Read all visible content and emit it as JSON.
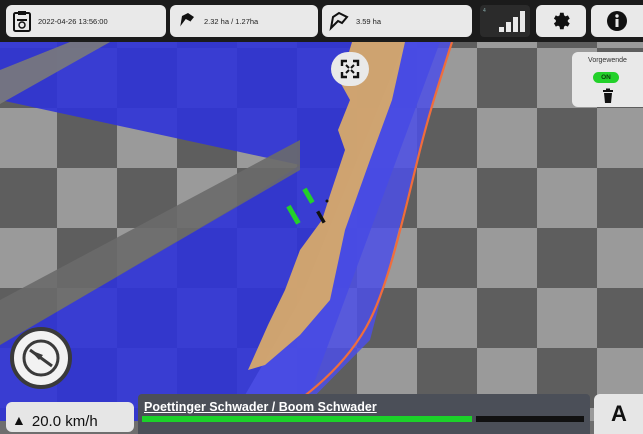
{
  "topbar": {
    "datetime": "2022-04-26 13:56:00",
    "area_worked": "2.32 ha / 1.27ha",
    "field_area": "3.59 ha"
  },
  "signal": {
    "level": 4,
    "caption": "4"
  },
  "headland": {
    "title": "Vorgewende",
    "state": "ON"
  },
  "status": {
    "speed": "20.0 km/h",
    "speed_icon": "arrow-up-icon"
  },
  "implement": {
    "name": "Poettinger Schwader / Boom Schwader",
    "progress": 0.73
  },
  "mode_button": "A",
  "colors": {
    "coverage_blue": "#3a3de0",
    "worked_tan": "#d4a76a",
    "boundary_orange": "#f06d3c",
    "active_green": "#23d12a"
  }
}
